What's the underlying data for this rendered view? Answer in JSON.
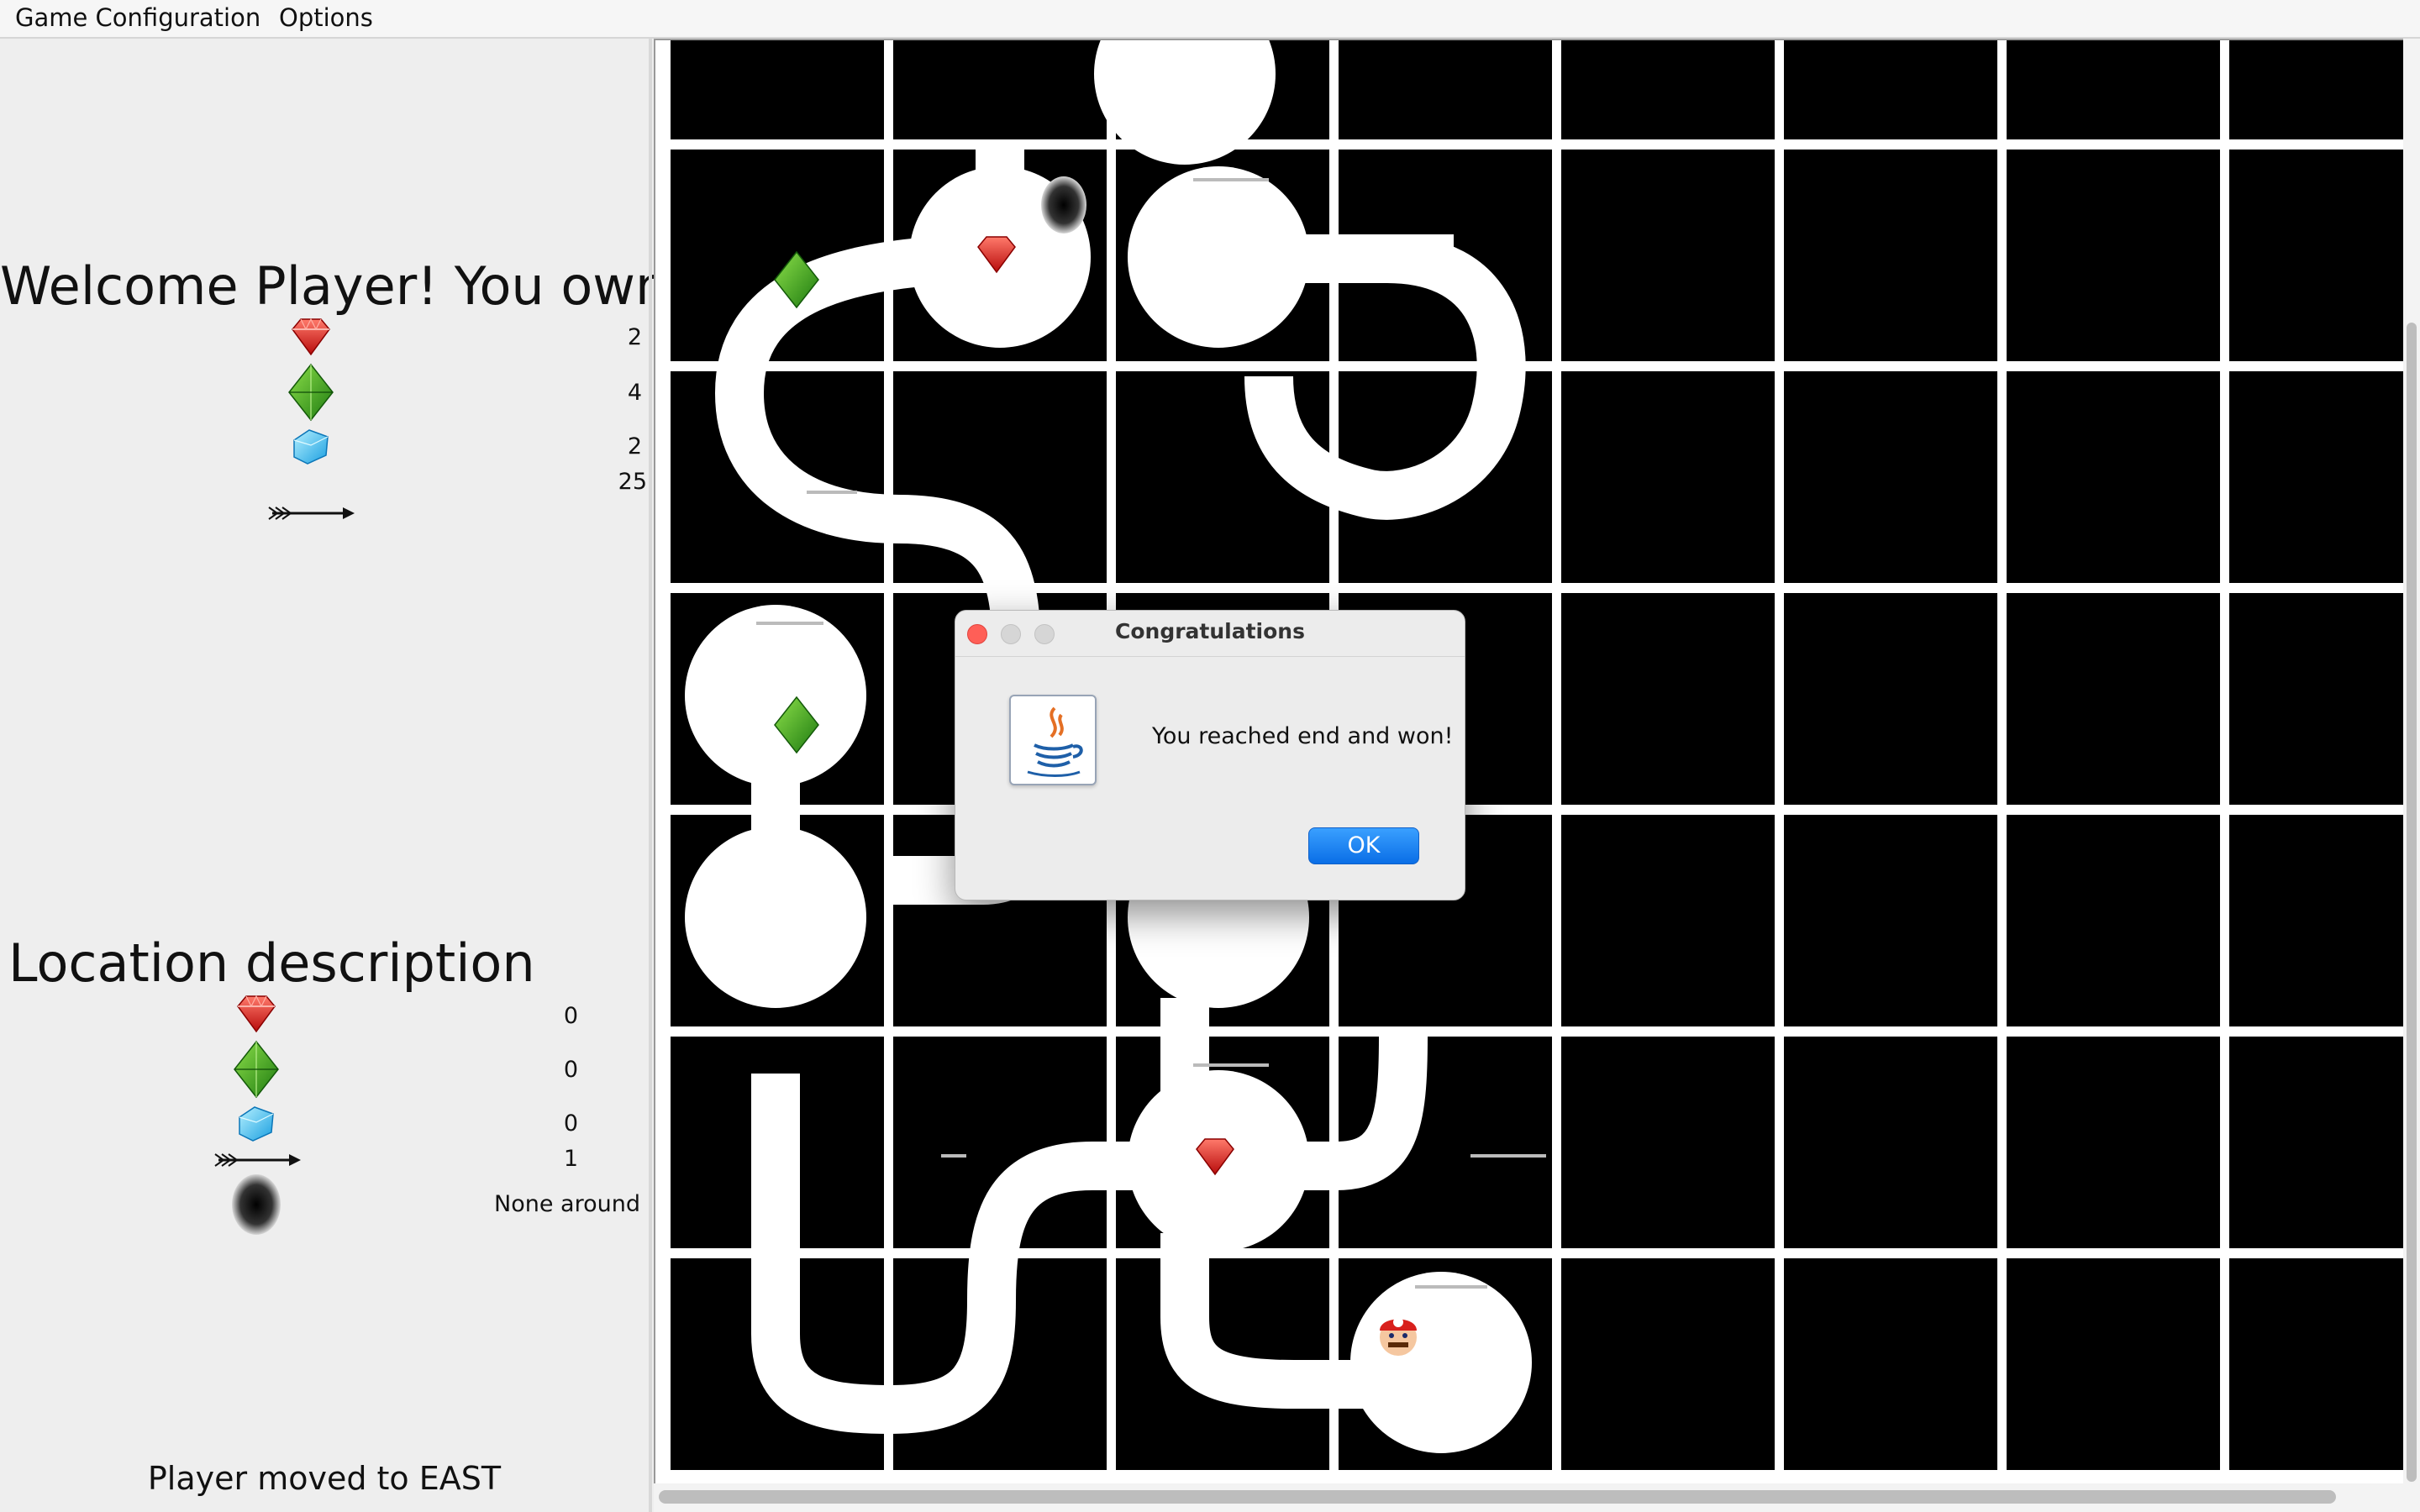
{
  "menubar": {
    "items": [
      "Game Configuration",
      "Options"
    ]
  },
  "player_panel": {
    "title": "Welcome Player! You own",
    "rows": [
      {
        "icon": "ruby-icon",
        "value": "2"
      },
      {
        "icon": "emerald-icon",
        "value": "4"
      },
      {
        "icon": "diamond-icon",
        "value": "2"
      },
      {
        "icon": "arrow-icon",
        "value": "25"
      }
    ]
  },
  "location_panel": {
    "title": "Location description",
    "rows": [
      {
        "icon": "ruby-icon",
        "value": "0"
      },
      {
        "icon": "emerald-icon",
        "value": "0"
      },
      {
        "icon": "diamond-icon",
        "value": "0"
      },
      {
        "icon": "arrow-icon",
        "value": "1"
      },
      {
        "icon": "pit-icon",
        "value": "None around"
      }
    ]
  },
  "status": "Player moved to EAST",
  "board": {
    "columns": 8,
    "rows": 7
  },
  "dialog": {
    "title": "Congratulations",
    "message": "You reached end and won!",
    "ok_label": "OK",
    "icon": "java-icon"
  },
  "colors": {
    "accent": "#0a7aff",
    "cell": "#000000",
    "path": "#ffffff"
  }
}
